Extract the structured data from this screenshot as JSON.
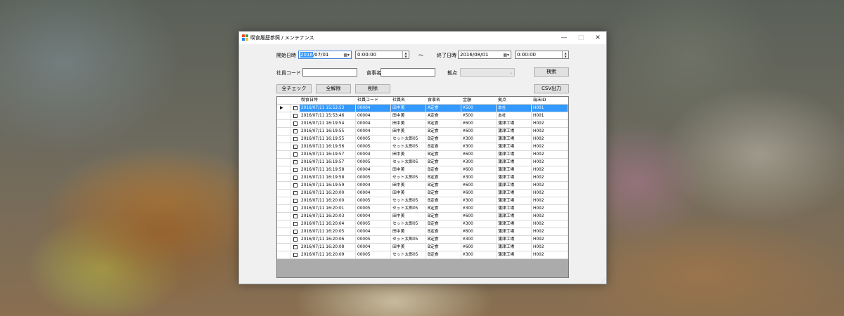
{
  "window": {
    "title": "喫食履歴参照 / メンテナンス",
    "minimize": "—",
    "maximize": "□",
    "close": "✕"
  },
  "filters": {
    "start_label": "開始日時",
    "start_date_sel": "2016",
    "start_date_rest": "/07/01",
    "start_time": "0:00:00",
    "tilde": "～",
    "end_label": "終了日時",
    "end_date": "2016/08/01",
    "end_time": "0:00:00",
    "employee_code_label": "社員コード",
    "employee_code_value": "",
    "meal_name_label": "食事名",
    "meal_name_value": "",
    "site_label": "拠点",
    "search_button": "検索"
  },
  "actions": {
    "check_all": "全チェック",
    "uncheck_all": "全解除",
    "delete": "削除",
    "csv_export": "CSV出力"
  },
  "grid": {
    "columns": [
      "喫食日時",
      "社員コード",
      "社員名",
      "食事名",
      "金額",
      "拠点",
      "端末ID"
    ],
    "selected_row": 0,
    "rows": [
      [
        "2016/07/11 15:53:53",
        "00004",
        "田中美",
        "A定食",
        "¥500",
        "本社",
        "H001"
      ],
      [
        "2016/07/11 15:53:46",
        "00004",
        "田中美",
        "A定食",
        "¥500",
        "本社",
        "H001"
      ],
      [
        "2016/07/11 16:19:54",
        "00004",
        "田中美",
        "B定食",
        "¥600",
        "蒲津工場",
        "H002"
      ],
      [
        "2016/07/11 16:19:55",
        "00004",
        "田中美",
        "B定食",
        "¥600",
        "蒲津工場",
        "H002"
      ],
      [
        "2016/07/11 16:19:55",
        "00005",
        "セット太郎05",
        "B定食",
        "¥300",
        "蒲津工場",
        "H002"
      ],
      [
        "2016/07/11 16:19:56",
        "00005",
        "セット太郎05",
        "B定食",
        "¥300",
        "蒲津工場",
        "H002"
      ],
      [
        "2016/07/11 16:19:57",
        "00004",
        "田中美",
        "B定食",
        "¥600",
        "蒲津工場",
        "H002"
      ],
      [
        "2016/07/11 16:19:57",
        "00005",
        "セット太郎05",
        "B定食",
        "¥300",
        "蒲津工場",
        "H002"
      ],
      [
        "2016/07/11 16:19:58",
        "00004",
        "田中美",
        "B定食",
        "¥600",
        "蒲津工場",
        "H002"
      ],
      [
        "2016/07/11 16:19:58",
        "00005",
        "セット太郎05",
        "B定食",
        "¥300",
        "蒲津工場",
        "H002"
      ],
      [
        "2016/07/11 16:19:59",
        "00004",
        "田中美",
        "B定食",
        "¥600",
        "蒲津工場",
        "H002"
      ],
      [
        "2016/07/11 16:20:00",
        "00004",
        "田中美",
        "B定食",
        "¥600",
        "蒲津工場",
        "H002"
      ],
      [
        "2016/07/11 16:20:00",
        "00005",
        "セット太郎05",
        "B定食",
        "¥300",
        "蒲津工場",
        "H002"
      ],
      [
        "2016/07/11 16:20:01",
        "00005",
        "セット太郎05",
        "B定食",
        "¥300",
        "蒲津工場",
        "H002"
      ],
      [
        "2016/07/11 16:20:03",
        "00004",
        "田中美",
        "B定食",
        "¥600",
        "蒲津工場",
        "H002"
      ],
      [
        "2016/07/11 16:20:04",
        "00005",
        "セット太郎05",
        "B定食",
        "¥300",
        "蒲津工場",
        "H002"
      ],
      [
        "2016/07/11 16:20:05",
        "00004",
        "田中美",
        "B定食",
        "¥600",
        "蒲津工場",
        "H002"
      ],
      [
        "2016/07/11 16:20:06",
        "00005",
        "セット太郎05",
        "B定食",
        "¥300",
        "蒲津工場",
        "H002"
      ],
      [
        "2016/07/11 16:20:08",
        "00004",
        "田中美",
        "B定食",
        "¥600",
        "蒲津工場",
        "H002"
      ],
      [
        "2016/07/11 16:20:09",
        "00005",
        "セット太郎05",
        "B定食",
        "¥300",
        "蒲津工場",
        "H002"
      ]
    ]
  },
  "icons": {
    "calendar": "calendar-icon",
    "dropdown": "chevron-down-icon",
    "spin": "spin-icon",
    "row_pointer": "row-pointer-icon"
  }
}
